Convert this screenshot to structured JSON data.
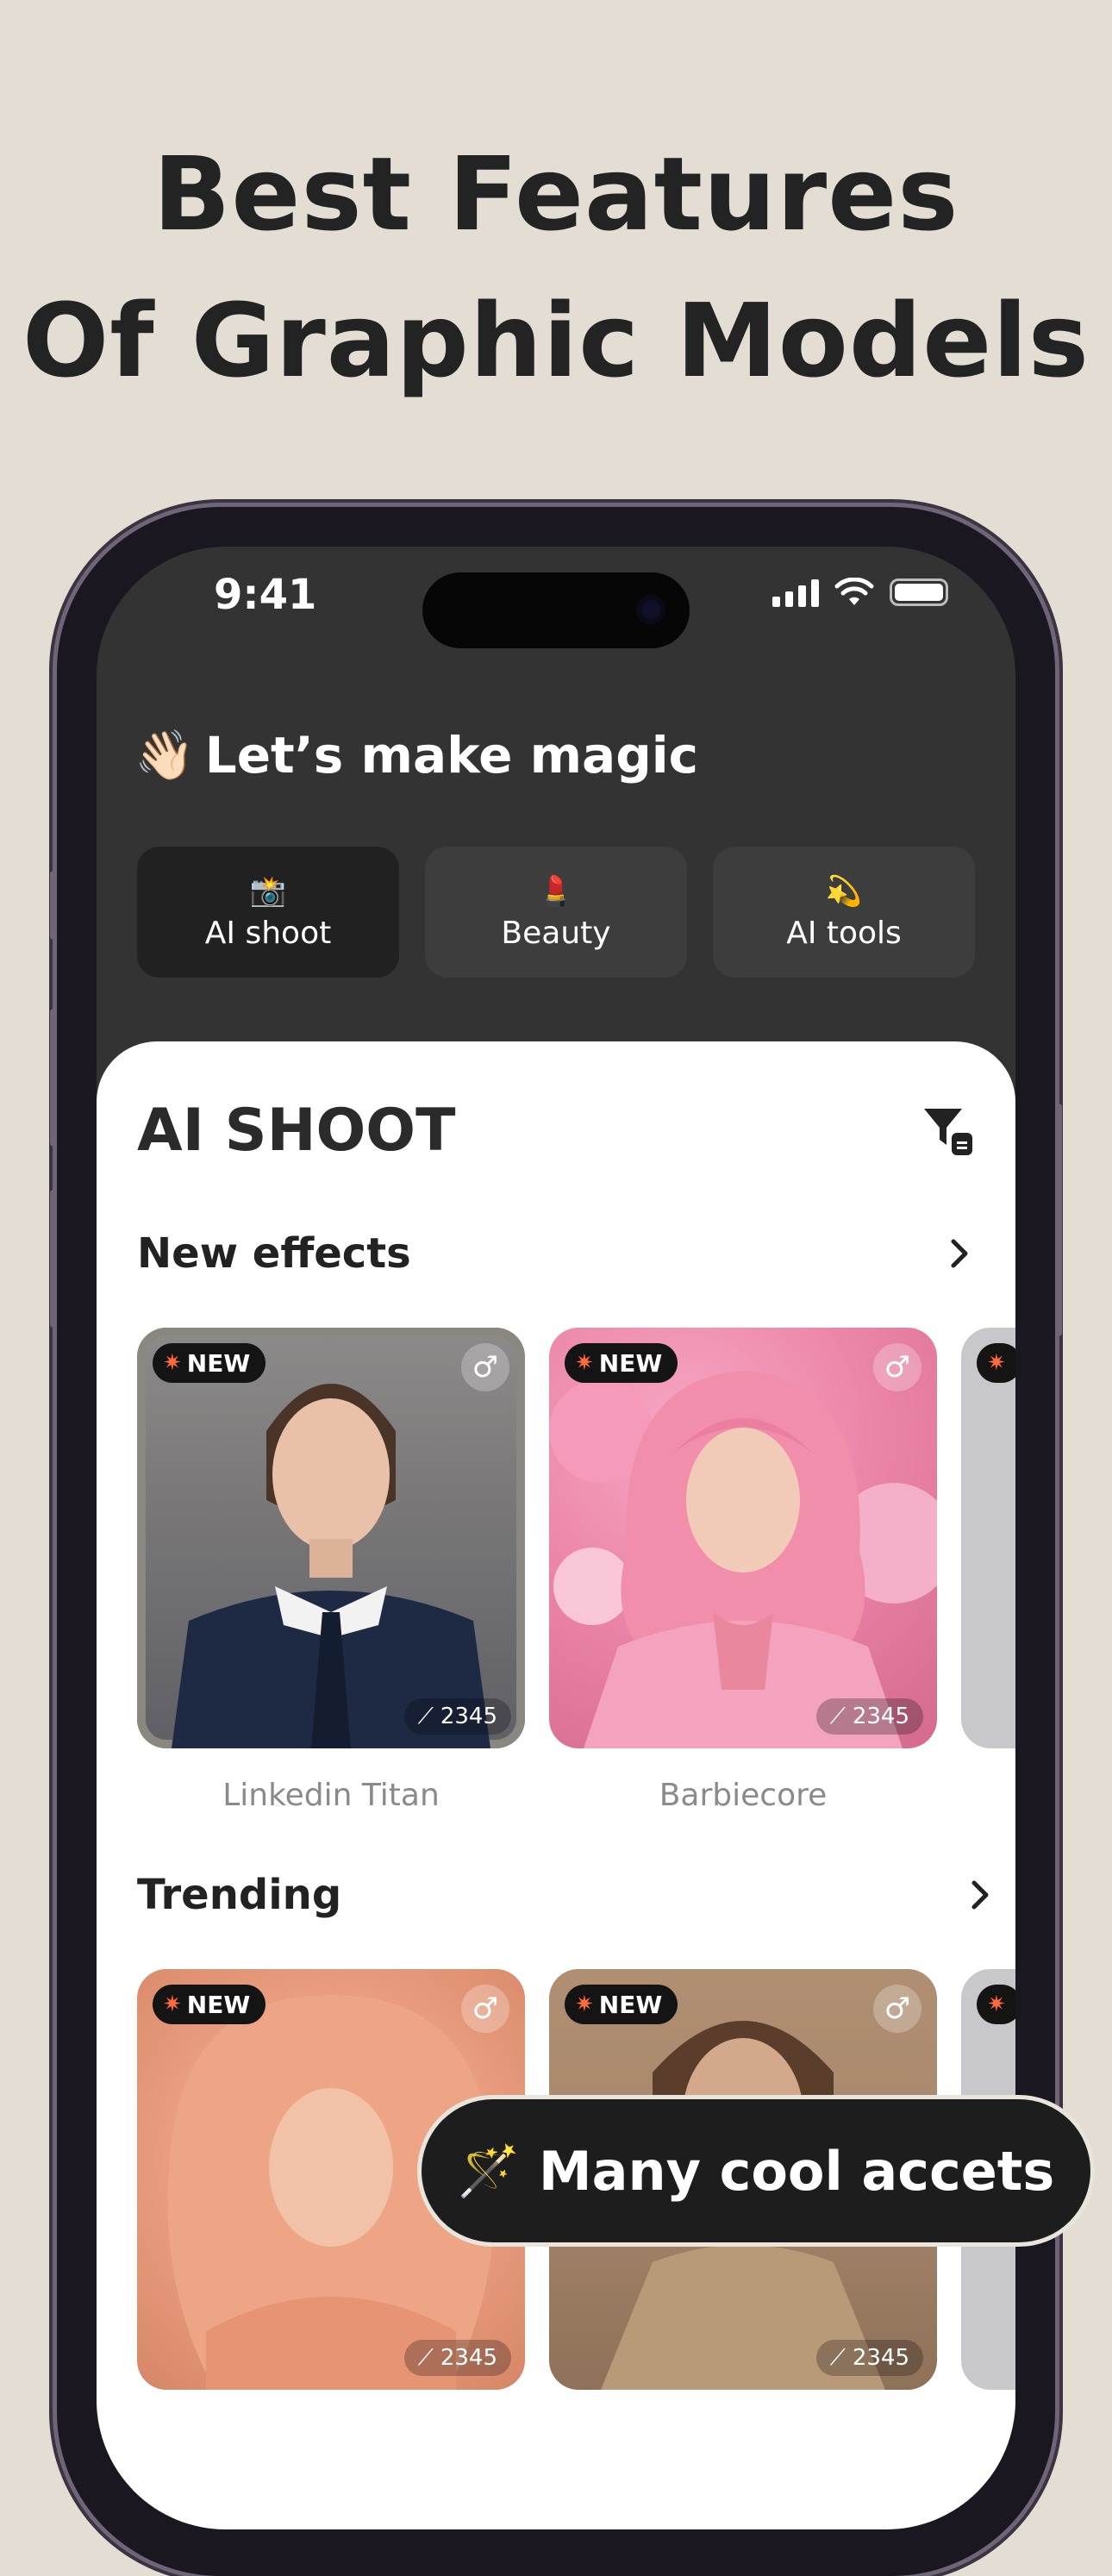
{
  "headline": {
    "line1": "Best Features",
    "line2": "Of Graphic Models"
  },
  "status_bar": {
    "time": "9:41"
  },
  "greeting": {
    "emoji": "👋🏻",
    "text": "Let’s make magic"
  },
  "tabs": [
    {
      "emoji": "📸",
      "label": "AI shoot",
      "active": true
    },
    {
      "emoji": "💄",
      "label": "Beauty",
      "active": false
    },
    {
      "emoji": "💫",
      "label": "AI tools",
      "active": false
    }
  ],
  "sheet": {
    "title": "AI SHOOT"
  },
  "sections": [
    {
      "title": "New effects",
      "cards": [
        {
          "badge": "NEW",
          "uses": "2345",
          "caption": "Linkedin Titan"
        },
        {
          "badge": "NEW",
          "uses": "2345",
          "caption": "Barbiecore"
        }
      ]
    },
    {
      "title": "Trending",
      "cards": [
        {
          "badge": "NEW",
          "uses": "2345"
        },
        {
          "badge": "NEW",
          "uses": "2345"
        }
      ]
    }
  ],
  "floating_pill": {
    "icon": "🪄",
    "text": "Many cool accets"
  },
  "icons": {
    "gender": "male-symbol-icon",
    "filter": "filter-icon",
    "wand": "magic-wand-icon",
    "chevron": "chevron-right-icon"
  },
  "colors": {
    "background": "#e4ddd3",
    "screen_dark": "#333333",
    "accent_badge": "#141414"
  }
}
